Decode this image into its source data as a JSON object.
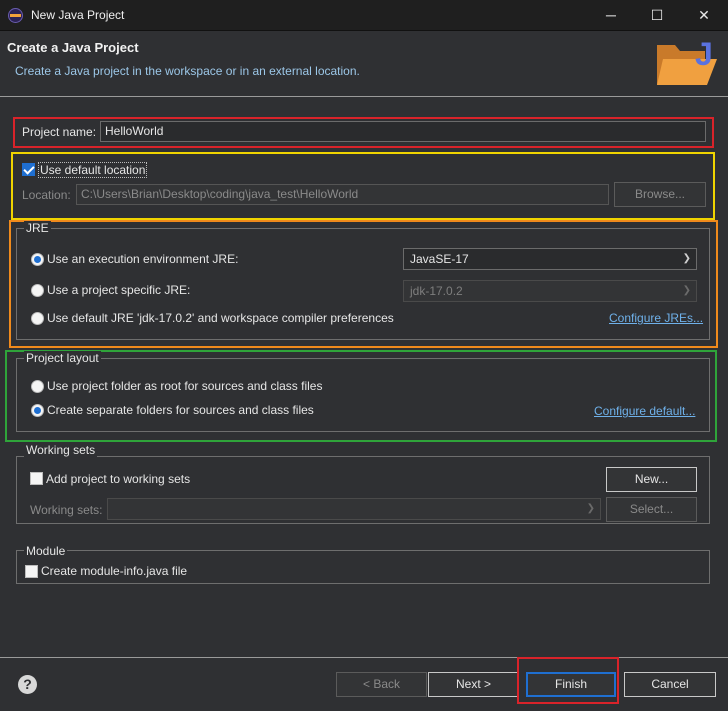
{
  "window": {
    "title": "New Java Project",
    "minimize_glyph": "─",
    "maximize_glyph": "☐",
    "close_glyph": "✕"
  },
  "header": {
    "title": "Create a Java Project",
    "subtitle": "Create a Java project in the workspace or in an external location."
  },
  "project_name": {
    "label": "Project name:",
    "value": "HelloWorld"
  },
  "location": {
    "use_default_label": "Use default location",
    "use_default_checked": true,
    "label": "Location:",
    "value": "C:\\Users\\Brian\\Desktop\\coding\\java_test\\HelloWorld",
    "browse_label": "Browse..."
  },
  "jre": {
    "group_label": "JRE",
    "options": [
      {
        "label": "Use an execution environment JRE:",
        "checked": true
      },
      {
        "label": "Use a project specific JRE:",
        "checked": false
      },
      {
        "label": "Use default JRE 'jdk-17.0.2' and workspace compiler preferences",
        "checked": false
      }
    ],
    "execution_env_value": "JavaSE-17",
    "project_jre_value": "jdk-17.0.2",
    "configure_link": "Configure JREs..."
  },
  "project_layout": {
    "group_label": "Project layout",
    "options": [
      {
        "label": "Use project folder as root for sources and class files",
        "checked": false
      },
      {
        "label": "Create separate folders for sources and class files",
        "checked": true
      }
    ],
    "configure_link": "Configure default..."
  },
  "working_sets": {
    "group_label": "Working sets",
    "add_label": "Add project to working sets",
    "add_checked": false,
    "new_label": "New...",
    "field_label": "Working sets:",
    "select_label": "Select..."
  },
  "module": {
    "group_label": "Module",
    "create_label": "Create module-info.java file",
    "create_checked": false
  },
  "footer": {
    "help_glyph": "?",
    "back_label": "< Back",
    "next_label": "Next >",
    "finish_label": "Finish",
    "cancel_label": "Cancel"
  },
  "colors": {
    "highlight_red": "#d9232a",
    "highlight_yellow": "#f0d400",
    "highlight_orange": "#f08a1c",
    "highlight_green": "#2fa43a",
    "link": "#6fb1ea",
    "accent": "#1f6fd1"
  },
  "icons": {
    "app": "eclipse-icon",
    "banner": "java-project-folder-icon"
  }
}
